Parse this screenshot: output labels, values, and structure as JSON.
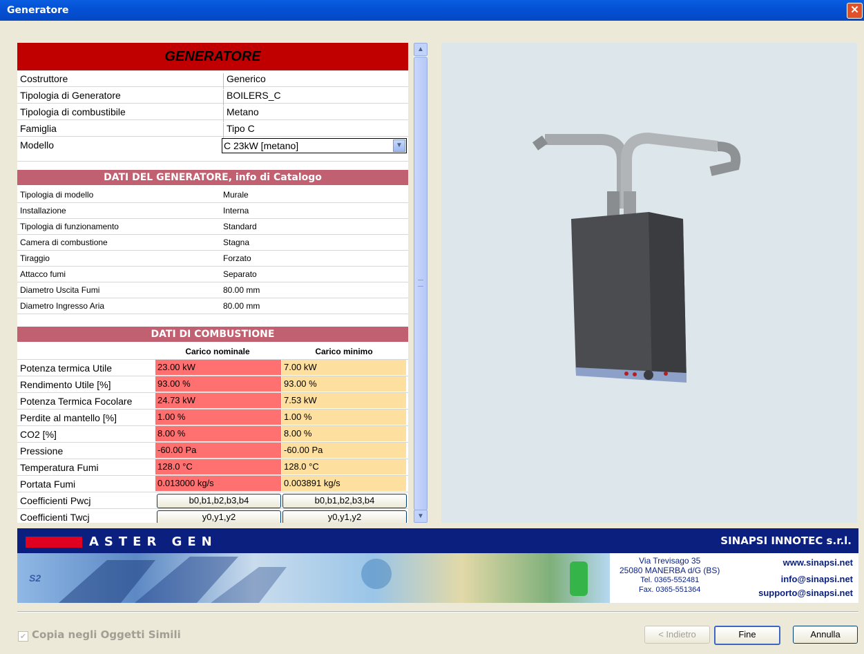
{
  "window": {
    "title": "Generatore"
  },
  "panel": {
    "header": "GENERATORE",
    "general": [
      {
        "label": "Costruttore",
        "value": "Generico"
      },
      {
        "label": "Tipologia di Generatore",
        "value": "BOILERS_C"
      },
      {
        "label": "Tipologia di combustibile",
        "value": "Metano"
      },
      {
        "label": "Famiglia",
        "value": "Tipo C"
      }
    ],
    "modello": {
      "label": "Modello",
      "value": "C 23kW [metano]"
    },
    "catalog_title": "DATI DEL GENERATORE, info di Catalogo",
    "catalog": [
      {
        "label": "Tipologia di modello",
        "value": "Murale"
      },
      {
        "label": "Installazione",
        "value": "Interna"
      },
      {
        "label": "Tipologia di funzionamento",
        "value": "Standard"
      },
      {
        "label": "Camera di combustione",
        "value": "Stagna"
      },
      {
        "label": "Tiraggio",
        "value": "Forzato"
      },
      {
        "label": "Attacco fumi",
        "value": "Separato"
      },
      {
        "label": "Diametro Uscita Fumi",
        "value": "80.00 mm"
      },
      {
        "label": "Diametro Ingresso Aria",
        "value": "80.00 mm"
      }
    ],
    "combustion_title": "DATI DI COMBUSTIONE",
    "col_nominal": "Carico nominale",
    "col_minimum": "Carico minimo",
    "combustion": [
      {
        "label": "Potenza termica Utile",
        "nominal": "23.00 kW",
        "minimum": "7.00 kW"
      },
      {
        "label": "Rendimento Utile [%]",
        "nominal": "93.00 %",
        "minimum": "93.00 %"
      },
      {
        "label": "Potenza Termica Focolare",
        "nominal": "24.73 kW",
        "minimum": "7.53 kW"
      },
      {
        "label": "Perdite al mantello [%]",
        "nominal": "1.00 %",
        "minimum": "1.00 %"
      },
      {
        "label": "CO2 [%]",
        "nominal": "8.00 %",
        "minimum": "8.00 %"
      },
      {
        "label": "Pressione",
        "nominal": "-60.00 Pa",
        "minimum": "-60.00 Pa"
      },
      {
        "label": "Temperatura Fumi",
        "nominal": "128.0 °C",
        "minimum": "128.0 °C"
      },
      {
        "label": "Portata Fumi",
        "nominal": "0.013000 kg/s",
        "minimum": "0.003891 kg/s"
      }
    ],
    "coeff": [
      {
        "label": "Coefficienti Pwcj",
        "btn": "b0,b1,b2,b3,b4"
      },
      {
        "label": "Coefficienti Twcj",
        "btn": "y0,y1,y2"
      }
    ]
  },
  "banner": {
    "product": "ASTER GEN",
    "company": "SINAPSI INNOTEC s.r.l.",
    "address1": "Via Trevisago 35",
    "address2": "25080 MANERBA d/G (BS)",
    "tel": "Tel. 0365-552481",
    "fax": "Fax. 0365-551364",
    "web": "www.sinapsi.net",
    "info": "info@sinapsi.net",
    "support": "supporto@sinapsi.net",
    "logo_mark": "S2"
  },
  "footer": {
    "checkbox_label": "Copia negli Oggetti Simili",
    "back_label": "< Indietro",
    "finish_label": "Fine",
    "cancel_label": "Annulla"
  },
  "colors": {
    "header_red": "#c00000",
    "section_rose": "#c06070",
    "nominal_cell": "#ff7070",
    "minimum_cell": "#fde0a0",
    "banner_navy": "#0a1f7e"
  }
}
